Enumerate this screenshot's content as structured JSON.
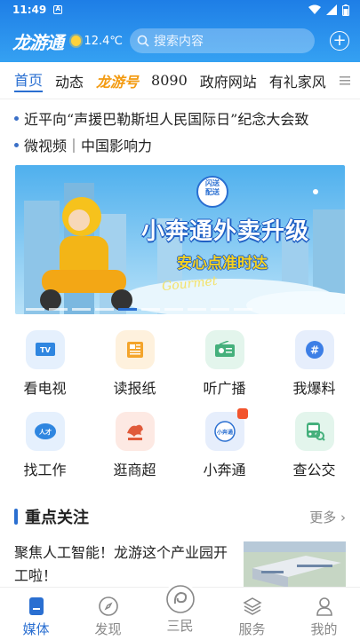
{
  "status": {
    "time": "11:49"
  },
  "header": {
    "logo": "龙游通",
    "temperature": "12.4℃",
    "search_placeholder": "搜索内容",
    "icons": {
      "weather": "sun-icon",
      "search": "search-icon",
      "add": "plus-circle-icon"
    }
  },
  "tabs": [
    {
      "label": "首页",
      "active": true
    },
    {
      "label": "动态"
    },
    {
      "label": "龙游号",
      "brand": true
    },
    {
      "label": "8090"
    },
    {
      "label": "政府网站"
    },
    {
      "label": "有礼家风"
    }
  ],
  "headlines": [
    "近平向“声援巴勒斯坦人民国际日”纪念大会致",
    "微视频｜中国影响力"
  ],
  "banner": {
    "badge_line1": "闪送",
    "badge_line2": "配送",
    "title": "小奔通外卖升级",
    "subtitle": "安心点准时达",
    "script_text": "Gourmet",
    "active_dot": 4,
    "dot_count": 10
  },
  "services": [
    {
      "label": "看电视",
      "icon": "tv-icon",
      "color": "#2f86e0",
      "bg": "#e5f0fd"
    },
    {
      "label": "读报纸",
      "icon": "newspaper-icon",
      "color": "#f4a42a",
      "bg": "#fef1dd"
    },
    {
      "label": "听广播",
      "icon": "radio-icon",
      "color": "#45b07c",
      "bg": "#e3f5ec"
    },
    {
      "label": "我爆料",
      "icon": "hashtag-icon",
      "color": "#3d7fe6",
      "bg": "#e6eefc"
    },
    {
      "label": "找工作",
      "icon": "job-icon",
      "color": "#2f86e0",
      "bg": "#e5f0fd"
    },
    {
      "label": "逛商超",
      "icon": "shop-dragon-icon",
      "color": "#e05a3a",
      "bg": "#fde9e3"
    },
    {
      "label": "小奔通",
      "icon": "xiaobentong-icon",
      "color": "#2a6fd1",
      "bg": "#e6eefc"
    },
    {
      "label": "查公交",
      "icon": "bus-icon",
      "color": "#45b07c",
      "bg": "#e3f5ec"
    }
  ],
  "focus": {
    "title": "重点关注",
    "more": "更多"
  },
  "news": {
    "title": "聚焦人工智能！龙游这个产业园开工啦！"
  },
  "bottom_nav": [
    {
      "label": "媒体",
      "icon": "media-icon",
      "active": true
    },
    {
      "label": "发现",
      "icon": "compass-icon"
    },
    {
      "label": "三民",
      "icon": "sanmin-icon"
    },
    {
      "label": "服务",
      "icon": "layers-icon"
    },
    {
      "label": "我的",
      "icon": "person-icon"
    }
  ],
  "colors": {
    "primary": "#2a6fd1",
    "header": "#2b8ef0",
    "brand": "#f39b12"
  }
}
